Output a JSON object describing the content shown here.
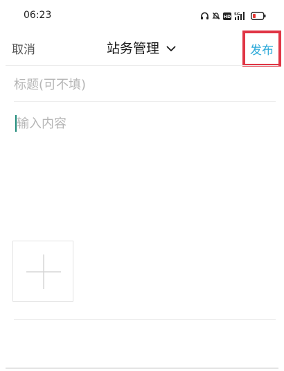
{
  "status_bar": {
    "time": "06:23",
    "icons": [
      "headphones-icon",
      "bell-mute-icon",
      "hd-icon",
      "5g-signal-icon",
      "battery-low-icon"
    ],
    "signal_label": "5G"
  },
  "nav": {
    "cancel_label": "取消",
    "title": "站务管理",
    "publish_label": "发布",
    "accent_color": "#2aa8d8",
    "highlight_color": "#e03545"
  },
  "form": {
    "title_placeholder": "标题(可不填)",
    "content_placeholder": "输入内容"
  },
  "add_image": {
    "icon": "plus-icon"
  }
}
